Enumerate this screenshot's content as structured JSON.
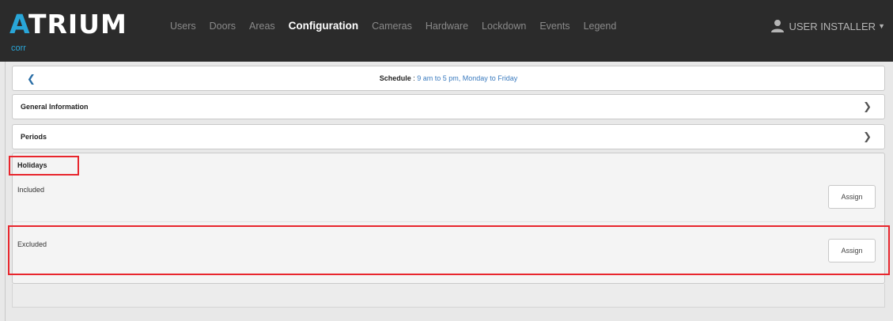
{
  "brand": {
    "name_a": "A",
    "name_b": "TRIUM",
    "sub": "corr"
  },
  "nav": {
    "items": [
      {
        "label": "Users"
      },
      {
        "label": "Doors"
      },
      {
        "label": "Areas"
      },
      {
        "label": "Configuration"
      },
      {
        "label": "Cameras"
      },
      {
        "label": "Hardware"
      },
      {
        "label": "Lockdown"
      },
      {
        "label": "Events"
      },
      {
        "label": "Legend"
      }
    ],
    "active": "Configuration"
  },
  "user": {
    "label": "USER INSTALLER",
    "icon": "user-icon"
  },
  "header": {
    "back_icon": "back-chevron-icon",
    "title_label": "Schedule",
    "title_sep": " : ",
    "title_value": "9 am to 5 pm, Monday to Friday"
  },
  "sections": {
    "general": {
      "label": "General Information",
      "icon": "chevron-right-icon"
    },
    "periods": {
      "label": "Periods",
      "icon": "chevron-right-icon"
    },
    "holidays": {
      "title": "Holidays",
      "included_label": "Included",
      "excluded_label": "Excluded",
      "assign_label": "Assign"
    }
  },
  "colors": {
    "topbar": "#2b2b2b",
    "accent": "#29a6d8",
    "link": "#3b7bbf",
    "highlight": "#e8262d"
  }
}
